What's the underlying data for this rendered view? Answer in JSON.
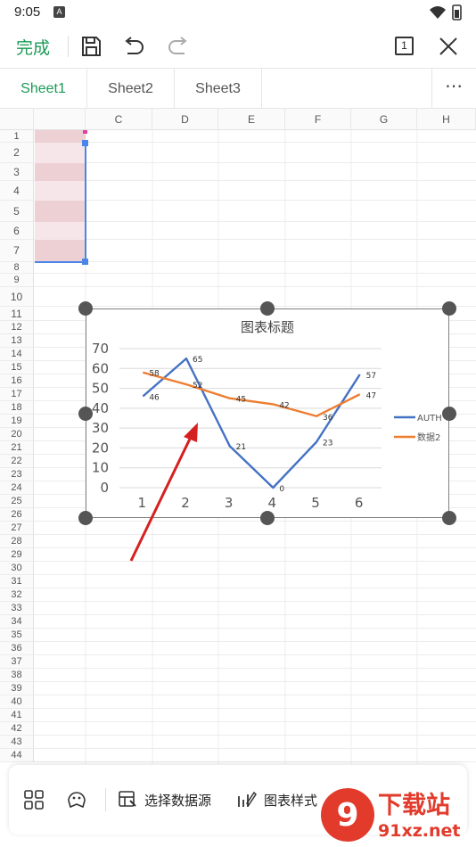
{
  "status": {
    "time": "9:05",
    "notification_letter": "A"
  },
  "toolbar": {
    "done_label": "完成",
    "sheet_count": "1"
  },
  "sheets": [
    {
      "label": "Sheet1",
      "active": true
    },
    {
      "label": "Sheet2",
      "active": false
    },
    {
      "label": "Sheet3",
      "active": false
    }
  ],
  "columns": [
    "C",
    "D",
    "E",
    "F",
    "G",
    "H"
  ],
  "row_numbers": [
    "1",
    "2",
    "3",
    "4",
    "5",
    "6",
    "7",
    "8",
    "9",
    "10",
    "11",
    "12",
    "13",
    "14",
    "15",
    "16",
    "17",
    "18",
    "19",
    "20",
    "21",
    "22",
    "23",
    "24",
    "25",
    "26",
    "27",
    "28",
    "29",
    "30",
    "31",
    "32",
    "33",
    "34",
    "35",
    "36",
    "37",
    "38",
    "39",
    "40",
    "41",
    "42",
    "43",
    "44"
  ],
  "chart_data": {
    "type": "line",
    "title": "图表标题",
    "categories": [
      "1",
      "2",
      "3",
      "4",
      "5",
      "6"
    ],
    "ylim": [
      0,
      70
    ],
    "yticks": [
      "0",
      "10",
      "20",
      "30",
      "40",
      "50",
      "60",
      "70"
    ],
    "grid": true,
    "legend_position": "right",
    "series": [
      {
        "name": "AUTH",
        "values": [
          46,
          65,
          21,
          0,
          23,
          57
        ],
        "color": "#4472c4"
      },
      {
        "name": "数据2",
        "values": [
          58,
          52,
          45,
          42,
          36,
          47
        ],
        "color": "#ed7d31"
      }
    ]
  },
  "bottom_bar": {
    "select_data_label": "选择数据源",
    "chart_style_label": "图表样式"
  },
  "watermark": {
    "text_main": "下载站",
    "text_url": "91xz.net"
  },
  "colors": {
    "accent": "#1a9a56",
    "selection": "#4a86e8",
    "annotation_arrow": "#d62020"
  }
}
